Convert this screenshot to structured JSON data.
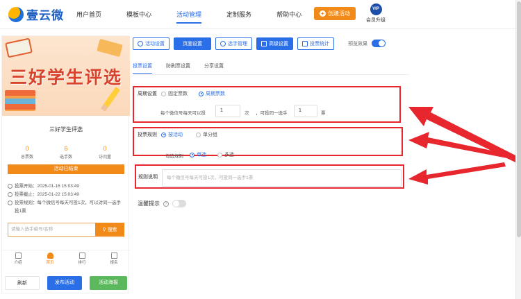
{
  "brand": {
    "name": "壹云微"
  },
  "nav": {
    "items": [
      {
        "label": "用户首页"
      },
      {
        "label": "模板中心"
      },
      {
        "label": "活动管理"
      },
      {
        "label": "定制服务"
      },
      {
        "label": "帮助中心"
      }
    ],
    "active": "活动管理"
  },
  "header": {
    "create_label": "创建活动",
    "vip_badge": "VIP",
    "vip_label": "会员升级"
  },
  "phone": {
    "banner_title": "三好学生评选",
    "card_title": "三好学生评选",
    "stats": [
      {
        "value": "0",
        "label": "总票数"
      },
      {
        "value": "6",
        "label": "选手数"
      },
      {
        "value": "0",
        "label": "访问量"
      }
    ],
    "ended_label": "活动已结束",
    "info": {
      "start": "投票开始：2025-01-16 15:03:49",
      "end": "投票截止：2025-01-22 15:03:49",
      "rule": "投票规则：每个微信号每天可投1次，可以对同一选手投1票"
    },
    "search_placeholder": "请输入选手编号/名称",
    "search_label": "搜索",
    "tabs": [
      {
        "label": "介绍"
      },
      {
        "label": "首页"
      },
      {
        "label": "排行"
      },
      {
        "label": "报名"
      }
    ],
    "buttons": {
      "refresh": "刷新",
      "publish": "发布活动",
      "poster": "活动海报"
    }
  },
  "toolbar": {
    "buttons": [
      {
        "label": "活动设置"
      },
      {
        "label": "页面设置"
      },
      {
        "label": "选手管理"
      },
      {
        "label": "高级设置"
      },
      {
        "label": "投票统计"
      }
    ],
    "preview_label": "预览效果",
    "preview_on": true
  },
  "subtabs": [
    {
      "label": "投票设置"
    },
    {
      "label": "防刷票设置"
    },
    {
      "label": "分享设置"
    }
  ],
  "period": {
    "label": "周期设置",
    "option_fixed": "固定票数",
    "option_cycle": "周期票数",
    "selected": "周期票数",
    "per_day_prefix": "每个微信号每天可以投",
    "per_day_value": "1",
    "per_day_unit": "次",
    "same_player_prefix": "，可投同一选手",
    "same_player_value": "1",
    "same_player_unit": "票"
  },
  "rule": {
    "label": "投票规则",
    "option_activity": "按活动",
    "option_group": "单分组",
    "selected": "按活动",
    "check_label": "勾选规则",
    "check_single": "单选",
    "check_multi": "多选",
    "check_selected": "单选"
  },
  "description": {
    "label": "规则说明",
    "placeholder": "每个微信号每天可投1次，可投同一选手1票"
  },
  "tip": {
    "label": "温馨提示",
    "on": false
  },
  "colors": {
    "accent": "#2a6ee8",
    "orange": "#f28a1a",
    "red": "#e8262e",
    "green": "#5cb85c"
  }
}
